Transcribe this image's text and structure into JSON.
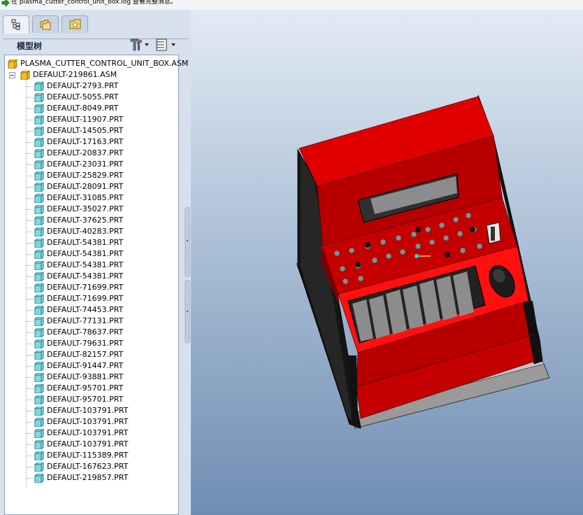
{
  "message_bar": {
    "text": "在 plasma_cutter_control_unit_box.log 查看完整消息。"
  },
  "tabs": [
    {
      "name": "model-tree-tab",
      "icon": "model-tree-icon",
      "active": true
    },
    {
      "name": "folder-browser-tab",
      "icon": "folder-icon",
      "active": false
    },
    {
      "name": "favorites-tab",
      "icon": "favorites-icon",
      "active": false
    }
  ],
  "model_tree": {
    "title": "模型树",
    "settings_icon": "settings-tools-icon",
    "show_icon": "show-menu-icon",
    "root": "PLASMA_CUTTER_CONTROL_UNIT_BOX.ASM",
    "subassembly": "DEFAULT-219861.ASM",
    "parts": [
      "DEFAULT-2793.PRT",
      "DEFAULT-5055.PRT",
      "DEFAULT-8049.PRT",
      "DEFAULT-11907.PRT",
      "DEFAULT-14505.PRT",
      "DEFAULT-17163.PRT",
      "DEFAULT-20837.PRT",
      "DEFAULT-23031.PRT",
      "DEFAULT-25829.PRT",
      "DEFAULT-28091.PRT",
      "DEFAULT-31085.PRT",
      "DEFAULT-35027.PRT",
      "DEFAULT-37625.PRT",
      "DEFAULT-40283.PRT",
      "DEFAULT-54381.PRT",
      "DEFAULT-54381.PRT",
      "DEFAULT-54381.PRT",
      "DEFAULT-54381.PRT",
      "DEFAULT-71699.PRT",
      "DEFAULT-71699.PRT",
      "DEFAULT-74453.PRT",
      "DEFAULT-77131.PRT",
      "DEFAULT-78637.PRT",
      "DEFAULT-79631.PRT",
      "DEFAULT-82157.PRT",
      "DEFAULT-91447.PRT",
      "DEFAULT-93881.PRT",
      "DEFAULT-95701.PRT",
      "DEFAULT-95701.PRT",
      "DEFAULT-103791.PRT",
      "DEFAULT-103791.PRT",
      "DEFAULT-103791.PRT",
      "DEFAULT-103791.PRT",
      "DEFAULT-115389.PRT",
      "DEFAULT-167623.PRT",
      "DEFAULT-219857.PRT"
    ]
  },
  "colors": {
    "box_red": "#d40000",
    "box_dark": "#111111",
    "part_icon": "#7fd9dd",
    "asm_icon": "#f0c419"
  }
}
